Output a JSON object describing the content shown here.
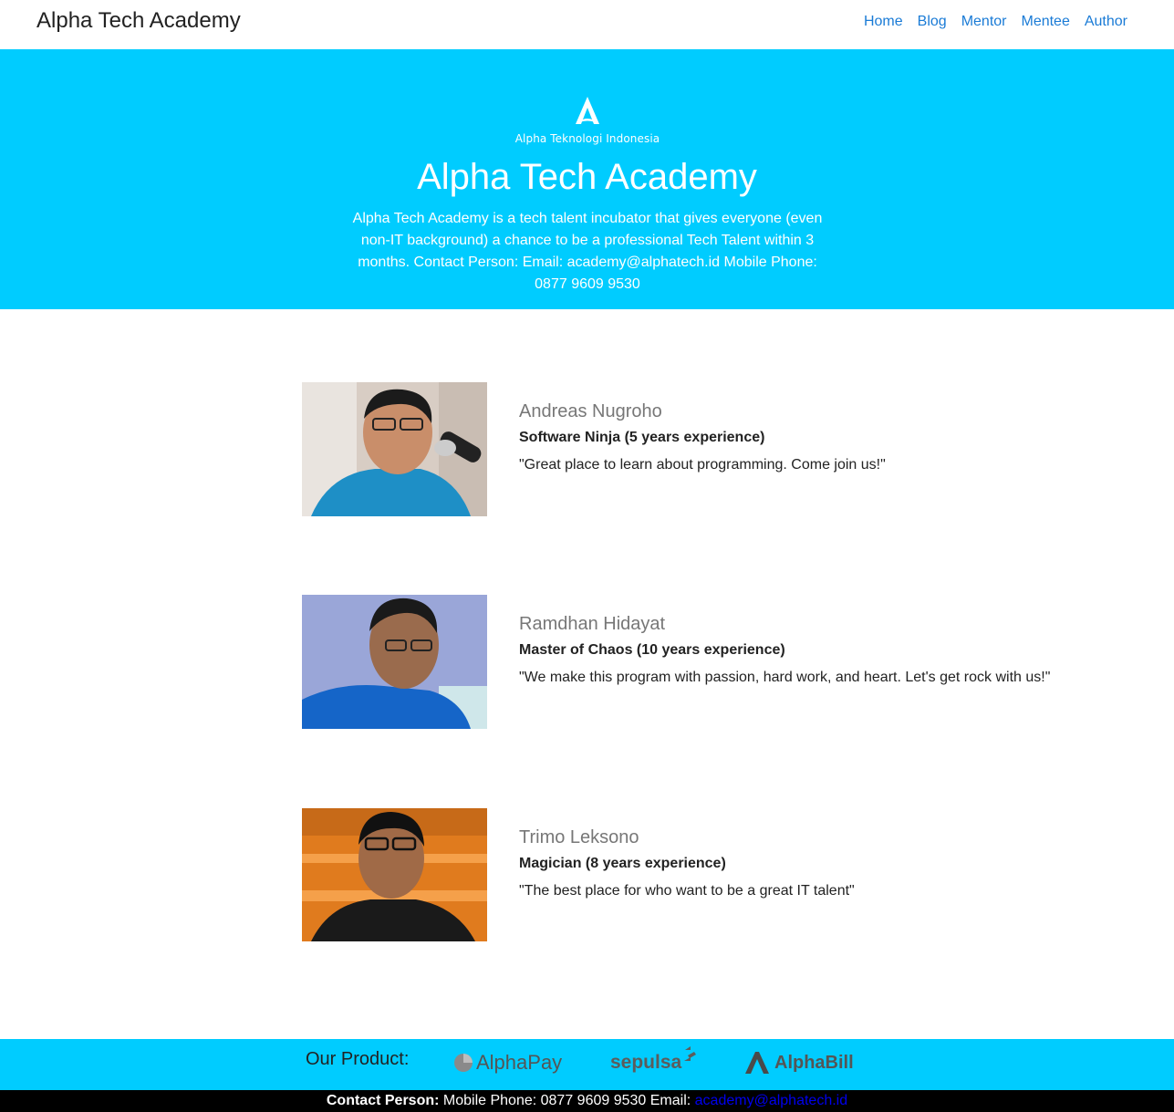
{
  "nav": {
    "brand": "Alpha Tech Academy",
    "links": [
      "Home",
      "Blog",
      "Mentor",
      "Mentee",
      "Author"
    ]
  },
  "hero": {
    "logo_text": "Alpha Teknologi Indonesia",
    "title": "Alpha Tech Academy",
    "description": "Alpha Tech Academy is a tech talent incubator that gives everyone (even non-IT background) a chance to be a professional Tech Talent within 3 months. Contact Person: Email: academy@alphatech.id Mobile Phone: 0877 9609 9530"
  },
  "mentors": [
    {
      "name": "Andreas Nugroho",
      "title": "Software Ninja (5 years experience)",
      "quote": "\"Great place to learn about programming. Come join us!\""
    },
    {
      "name": "Ramdhan Hidayat",
      "title": "Master of Chaos (10 years experience)",
      "quote": "\"We make this program with passion, hard work, and heart. Let's get rock with us!\""
    },
    {
      "name": "Trimo Leksono",
      "title": "Magician (8 years experience)",
      "quote": "\"The best place for who want to be a great IT talent\""
    }
  ],
  "products": {
    "label": "Our Product:",
    "items": [
      "AlphaPay",
      "sepulsa",
      "AlphaBill"
    ]
  },
  "contact": {
    "label": "Contact Person:",
    "details": " Mobile Phone: 0877 9609 9530 Email: ",
    "email": "academy@alphatech.id"
  },
  "colors": {
    "hero_bg": "#00ccff",
    "nav_link": "#1a7bd6",
    "contact_bg": "#000000",
    "email_link": "#0000ee"
  }
}
